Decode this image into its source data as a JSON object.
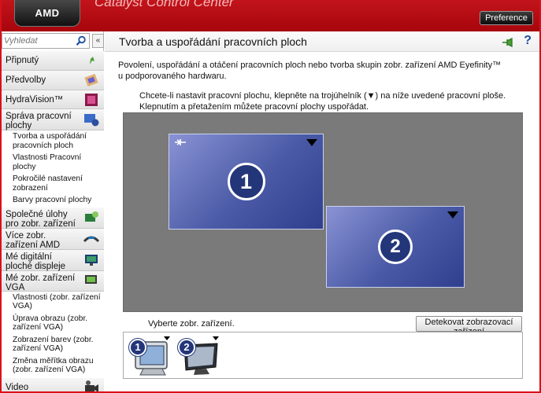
{
  "header": {
    "logo_text": "AMD",
    "app_title": "Catalyst Control Center",
    "preference_label": "Preference"
  },
  "sidebar": {
    "search_placeholder": "Vyhledat",
    "collapse_label": "«",
    "items": [
      {
        "label": "Připnutý",
        "icon": "pin-icon"
      },
      {
        "label": "Předvolby",
        "icon": "presets-icon"
      },
      {
        "label": "HydraVision™",
        "icon": "hydravision-icon"
      },
      {
        "label": "Správa pracovní plochy",
        "icon": "desktop-management-icon",
        "subitems": [
          "Tvorba a uspořádání pracovních ploch",
          "Vlastnosti Pracovní plochy",
          "Pokročilé nastavení zobrazení",
          "Barvy pracovní plochy"
        ]
      },
      {
        "label": "Společné úlohy pro zobr. zařízení",
        "icon": "common-tasks-icon"
      },
      {
        "label": "Více zobr. zařízení AMD Eyefinity™",
        "icon": "eyefinity-icon"
      },
      {
        "label": "Mé digitální ploché displeje",
        "icon": "flat-panel-icon"
      },
      {
        "label": "Mé zobr. zařízení VGA",
        "icon": "vga-display-icon",
        "subitems": [
          "Vlastnosti (zobr. zařízení VGA)",
          "Úprava obrazu (zobr. zařízení VGA)",
          "Zobrazení barev (zobr. zařízení VGA)",
          "Změna měřítka obrazu (zobr. zařízení VGA)"
        ]
      },
      {
        "label": "Video",
        "icon": "video-icon"
      }
    ]
  },
  "main": {
    "title": "Tvorba a uspořádání pracovních ploch",
    "description": "Povolení, uspořádání a otáčení pracovních ploch nebo tvorba skupin zobr. zařízení AMD Eyefinity™ u podporovaného hardwaru.",
    "instruction_line1": "Chcete-li nastavit pracovní plochu, klepněte na trojúhelník (▼) na níže uvedené pracovní ploše.",
    "instruction_line2": "Klepnutím a přetažením můžete pracovní plochy uspořádat.",
    "desktops": [
      {
        "number": "1",
        "primary": true
      },
      {
        "number": "2",
        "primary": false
      }
    ],
    "select_devices_label": "Vyberte zobr. zařízení.",
    "detect_button_label": "Detekovat zobrazovací zařízení",
    "devices": [
      {
        "number": "1",
        "type": "crt-monitor-icon"
      },
      {
        "number": "2",
        "type": "flat-panel-icon"
      }
    ]
  },
  "colors": {
    "brand_red": "#bf0a12",
    "desktop_blue": "#4a5aa6",
    "badge_blue": "#233679"
  }
}
